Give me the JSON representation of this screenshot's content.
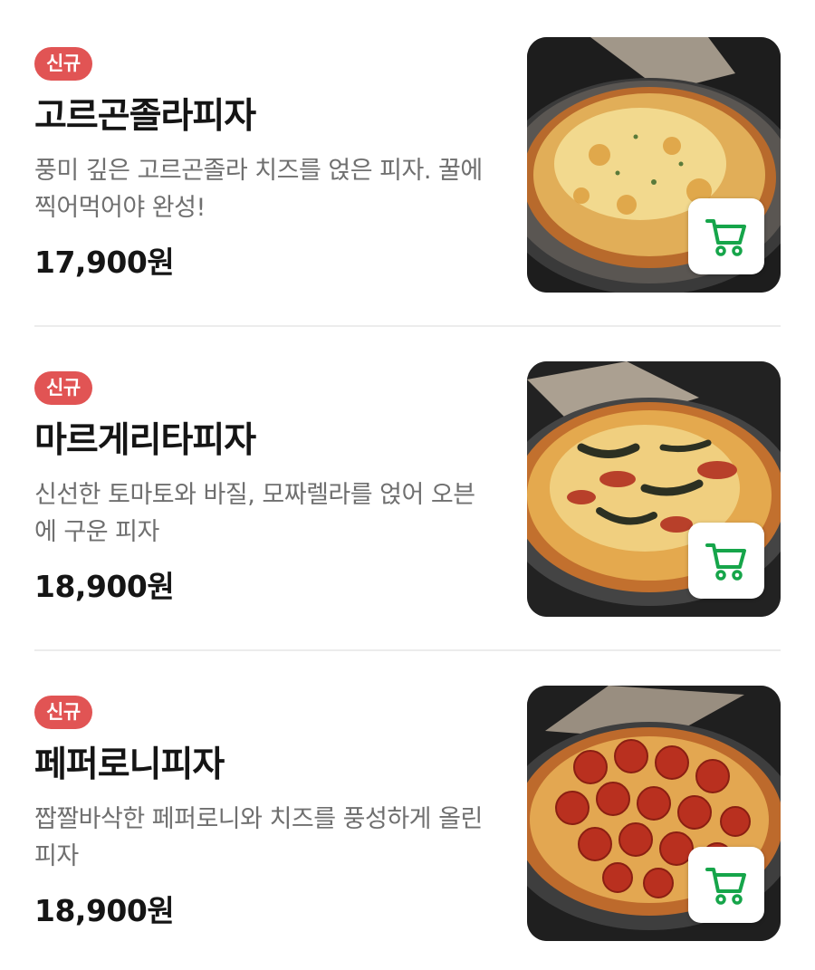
{
  "accent_color": "#e15454",
  "cart_color": "#16a54a",
  "menu": {
    "items": [
      {
        "badge": "신규",
        "name": "고르곤졸라피자",
        "description": "풍미 깊은 고르곤졸라 치즈를 얹은 피자. 꿀에 찍어먹어야 완성!",
        "price": "17,900원",
        "image_alt": "고르곤졸라피자",
        "cart_icon": "shopping-cart-icon"
      },
      {
        "badge": "신규",
        "name": "마르게리타피자",
        "description": "신선한 토마토와 바질, 모짜렐라를 얹어 오븐에 구운 피자",
        "price": "18,900원",
        "image_alt": "마르게리타피자",
        "cart_icon": "shopping-cart-icon"
      },
      {
        "badge": "신규",
        "name": "페퍼로니피자",
        "description": "짭짤바삭한 페퍼로니와 치즈를 풍성하게 올린 피자",
        "price": "18,900원",
        "image_alt": "페퍼로니피자",
        "cart_icon": "shopping-cart-icon"
      }
    ]
  }
}
